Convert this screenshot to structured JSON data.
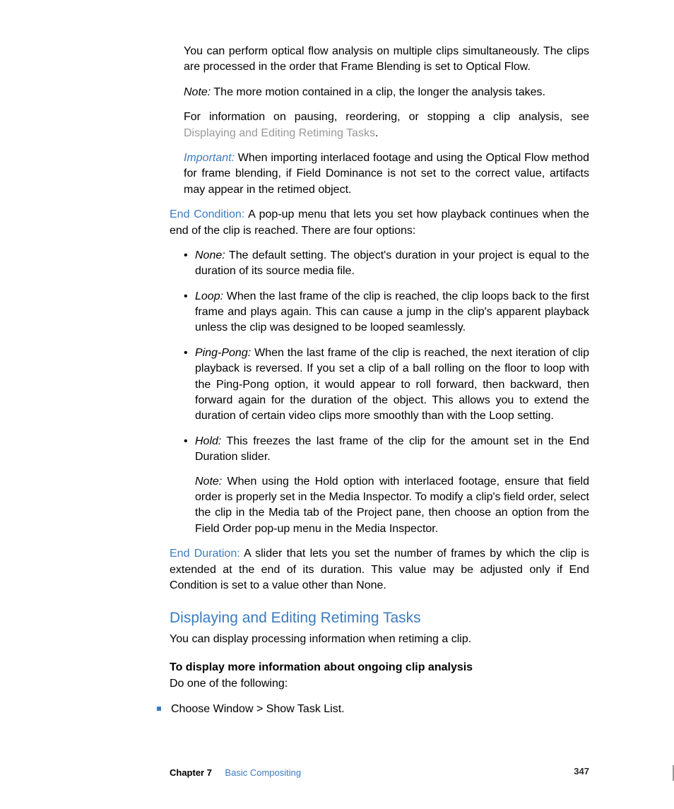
{
  "intro": {
    "para1": "You can perform optical flow analysis on multiple clips simultaneously. The clips are processed in the order that Frame Blending is set to Optical Flow.",
    "note_label": "Note:",
    "note_text": "  The more motion contained in a clip, the longer the analysis takes.",
    "para2_a": "For information on pausing, reordering, or stopping a clip analysis, see ",
    "para2_link": "Displaying and Editing Retiming Tasks",
    "para2_b": ".",
    "important_label": "Important:",
    "important_text": "  When importing interlaced footage and using the Optical Flow method for frame blending, if Field Dominance is not set to the correct value, artifacts may appear in the retimed object."
  },
  "end_condition": {
    "label": "End Condition:",
    "text": "  A pop-up menu that lets you set how playback continues when the end of the clip is reached. There are four options:",
    "items": [
      {
        "term": "None:",
        "text": "  The default setting. The object's duration in your project is equal to the duration of its source media file."
      },
      {
        "term": "Loop:",
        "text": "  When the last frame of the clip is reached, the clip loops back to the first frame and plays again. This can cause a jump in the clip's apparent playback unless the clip was designed to be looped seamlessly."
      },
      {
        "term": "Ping-Pong:",
        "text": "  When the last frame of the clip is reached, the next iteration of clip playback is reversed. If you set a clip of a ball rolling on the floor to loop with the Ping-Pong option, it would appear to roll forward, then backward, then forward again for the duration of the object. This allows you to extend the duration of certain video clips more smoothly than with the Loop setting."
      },
      {
        "term": "Hold:",
        "text": "  This freezes the last frame of the clip for the amount set in the End Duration slider.",
        "note_label": "Note:",
        "note_text": "  When using the Hold option with interlaced footage, ensure that field order is properly set in the Media Inspector. To modify a clip's field order, select the clip in the Media tab of the Project pane, then choose an option from the Field Order pop-up menu in the Media Inspector."
      }
    ]
  },
  "end_duration": {
    "label": "End Duration:",
    "text": "  A slider that lets you set the number of frames by which the clip is extended at the end of its duration. This value may be adjusted only if End Condition is set to a value other than None."
  },
  "section": {
    "heading": "Displaying and Editing Retiming Tasks",
    "intro": "You can display processing information when retiming a clip.",
    "sub": "To display more information about ongoing clip analysis",
    "do": "Do one of the following:",
    "step": "Choose Window > Show Task List."
  },
  "footer": {
    "chapter": "Chapter 7",
    "title": "Basic Compositing",
    "page": "347"
  }
}
